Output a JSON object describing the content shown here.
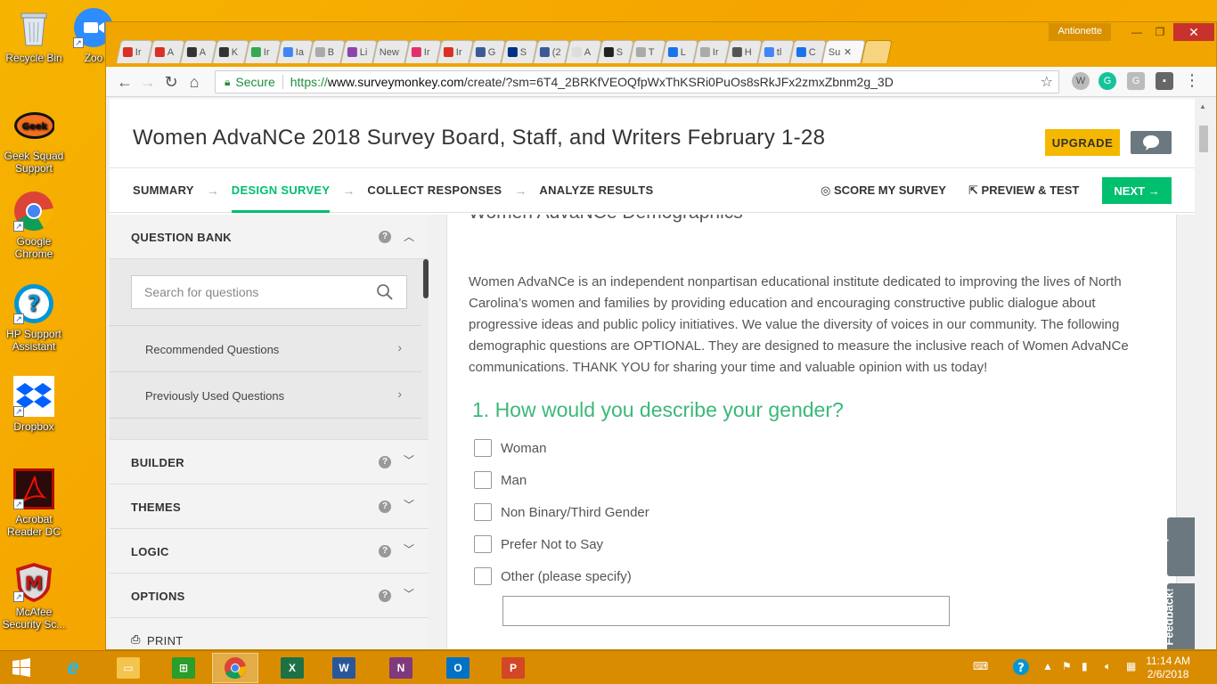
{
  "desktop": {
    "icons": [
      {
        "label": "Recycle Bin"
      },
      {
        "label": "Zoo"
      },
      {
        "label": "Geek Squad Support"
      },
      {
        "label": "Google Chrome"
      },
      {
        "label": "HP Support Assistant"
      },
      {
        "label": "Dropbox"
      },
      {
        "label": "Acrobat Reader DC"
      },
      {
        "label": "McAfee Security Sc..."
      }
    ]
  },
  "window": {
    "user": "Antionette",
    "tabs": [
      "Ir",
      "A",
      "A",
      "K",
      "Ir",
      "Ia",
      "B",
      "Li",
      "New",
      "Ir",
      "Ir",
      "G",
      "S",
      "(2",
      "A",
      "S",
      "T",
      "L",
      "Ir",
      "H",
      "tl",
      "C",
      "Su"
    ],
    "active_tab_close": "✕"
  },
  "toolbar": {
    "secure_label": "Secure",
    "url_prefix": "https://",
    "url_host": "www.surveymonkey.com",
    "url_path": "/create/?sm=6T4_2BRKfVEOQfpWxThKSRi0PuOs8sRkJFx2zmxZbnm2g_3D"
  },
  "header": {
    "survey_title": "Women AdvaNCe 2018 Survey Board, Staff, and Writers February 1-28",
    "upgrade_label": "UPGRADE"
  },
  "steps": {
    "items": [
      "SUMMARY",
      "DESIGN SURVEY",
      "COLLECT RESPONSES",
      "ANALYZE RESULTS"
    ],
    "score_label": "SCORE MY SURVEY",
    "preview_label": "PREVIEW & TEST",
    "next_label": "NEXT"
  },
  "sidebar": {
    "question_bank_label": "QUESTION BANK",
    "search_placeholder": "Search for questions",
    "rows": [
      "Recommended Questions",
      "Previously Used Questions"
    ],
    "sections": [
      "BUILDER",
      "THEMES",
      "LOGIC",
      "OPTIONS"
    ],
    "print_label": "PRINT"
  },
  "survey": {
    "page_title": "Women AdvaNCe Demographics",
    "intro": "Women AdvaNCe is an independent nonpartisan educational institute dedicated to improving the lives of North Carolina’s women and families by providing education and encouraging constructive public dialogue about progressive ideas and public policy initiatives. We value the diversity of voices in our community. The following demographic questions are OPTIONAL. They are designed to measure the inclusive reach of Women AdvaNCe communications. THANK YOU for sharing your time and valuable opinion with us today!",
    "question": "1. How would you describe your gender?",
    "options": [
      "Woman",
      "Man",
      "Non Binary/Third Gender",
      "Prefer Not to Say",
      "Other (please specify)"
    ]
  },
  "side_tabs": {
    "help": "Help!",
    "feedback": "Feedback!"
  },
  "taskbar": {
    "clock_time": "11:14 AM",
    "clock_date": "2/6/2018"
  },
  "colors": {
    "accent_green": "#00bf6f",
    "question_green": "#3cb878",
    "upgrade_yellow": "#f5b800",
    "desktop_orange": "#f5a300"
  }
}
